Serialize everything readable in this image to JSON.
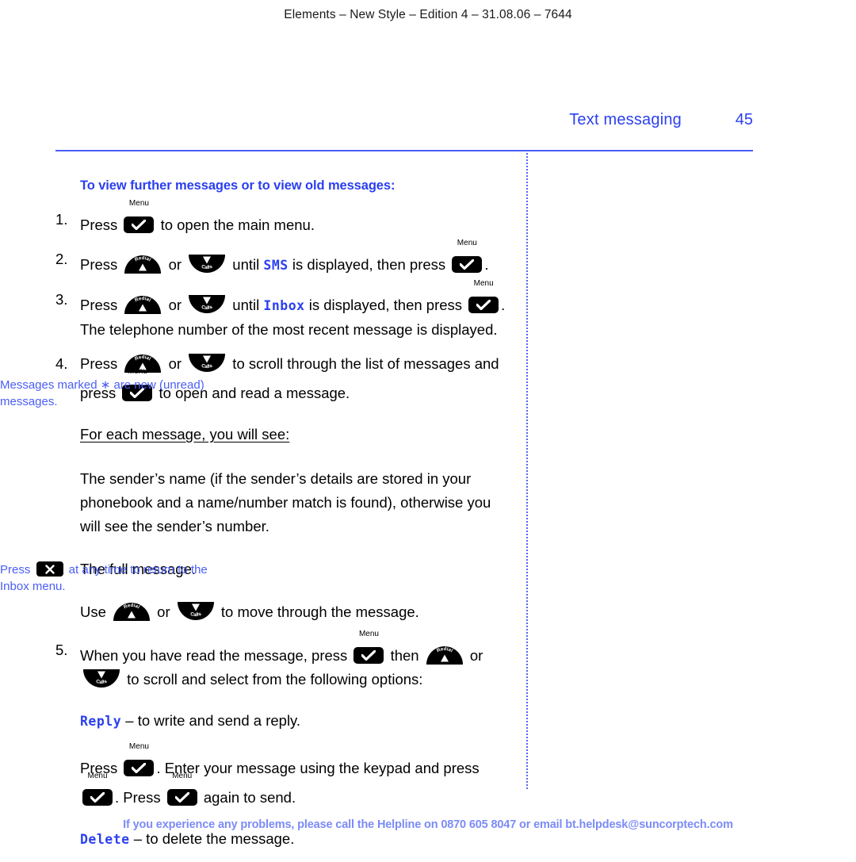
{
  "running_head": "Elements – New Style – Edition 4 – 31.08.06 – 7644",
  "header": {
    "chapter_title": "Text messaging",
    "page_number": "45"
  },
  "colors": {
    "accent_blue": "#2b3ff0",
    "rule_blue": "#4a5ef5",
    "note_blue": "#4a5ef5",
    "footer_blue": "#7b8bf7",
    "key_black": "#000000"
  },
  "keys": {
    "menu_caption": "Menu",
    "up_caption": "Redial",
    "down_caption": "Calls",
    "cancel_glyph": "✕",
    "menu_glyph": "✓"
  },
  "main": {
    "section_heading": "To view further messages or to view old messages:",
    "steps": [
      {
        "number": "1.",
        "parts": [
          {
            "type": "text",
            "value": "Press "
          },
          {
            "type": "key",
            "value": "menu"
          },
          {
            "type": "text",
            "value": " to open the main menu."
          }
        ]
      },
      {
        "number": "2.",
        "parts": [
          {
            "type": "text",
            "value": "Press "
          },
          {
            "type": "key",
            "value": "up"
          },
          {
            "type": "text",
            "value": " or "
          },
          {
            "type": "key",
            "value": "down"
          },
          {
            "type": "text",
            "value": " until "
          },
          {
            "type": "lcd",
            "value": "SMS"
          },
          {
            "type": "text",
            "value": " is displayed, then press "
          },
          {
            "type": "key",
            "value": "menu"
          },
          {
            "type": "text",
            "value": "."
          }
        ]
      },
      {
        "number": "3.",
        "parts": [
          {
            "type": "text",
            "value": "Press "
          },
          {
            "type": "key",
            "value": "up"
          },
          {
            "type": "text",
            "value": " or "
          },
          {
            "type": "key",
            "value": "down"
          },
          {
            "type": "text",
            "value": " until "
          },
          {
            "type": "lcd",
            "value": "Inbox"
          },
          {
            "type": "text",
            "value": " is displayed, then press "
          },
          {
            "type": "key",
            "value": "menu"
          },
          {
            "type": "text",
            "value": ". The telephone number of the most recent message is displayed."
          }
        ]
      },
      {
        "number": "4.",
        "parts": [
          {
            "type": "text",
            "value": "Press "
          },
          {
            "type": "key",
            "value": "up"
          },
          {
            "type": "text",
            "value": " or "
          },
          {
            "type": "key",
            "value": "down"
          },
          {
            "type": "text",
            "value": " to scroll through the list of messages and press "
          },
          {
            "type": "key",
            "value": "menu"
          },
          {
            "type": "text",
            "value": " to open and read a message."
          }
        ]
      },
      {
        "number": "5.",
        "parts": [
          {
            "type": "text",
            "value": "When you have read the message, press "
          },
          {
            "type": "key",
            "value": "menu"
          },
          {
            "type": "text",
            "value": " then "
          },
          {
            "type": "key",
            "value": "up"
          },
          {
            "type": "text",
            "value": " or "
          },
          {
            "type": "key",
            "value": "down"
          },
          {
            "type": "text",
            "value": " to scroll and select from the following options:"
          }
        ]
      }
    ],
    "for_each_message_label": "For each message, you will see:",
    "sender_paragraph": "The sender’s name (if the sender’s details are stored in your phonebook and a name/number match is found), otherwise you will see the sender’s number.",
    "full_message_paragraph": "The full message.",
    "move_through": {
      "prefix": "Use ",
      "middle": " or ",
      "suffix": " to move through the message."
    },
    "reply_option": {
      "label": "Reply",
      "description": " – to write and send a reply."
    },
    "reply_instructions": {
      "p1": "Press ",
      "p2": ". Enter your message using the keypad and press ",
      "p3": ". Press ",
      "p4": " again to send."
    },
    "delete_option": {
      "label": "Delete",
      "description": " – to delete the message."
    }
  },
  "side_notes": {
    "unread": {
      "prefix": "Messages marked ",
      "symbol": "∗",
      "suffix": " are new (unread) messages."
    },
    "return": {
      "prefix": "Press ",
      "suffix": " at any time to return to the Inbox menu."
    }
  },
  "footer": "If you experience any problems, please call the Helpline on 0870 605 8047 or email bt.helpdesk@suncorptech.com"
}
